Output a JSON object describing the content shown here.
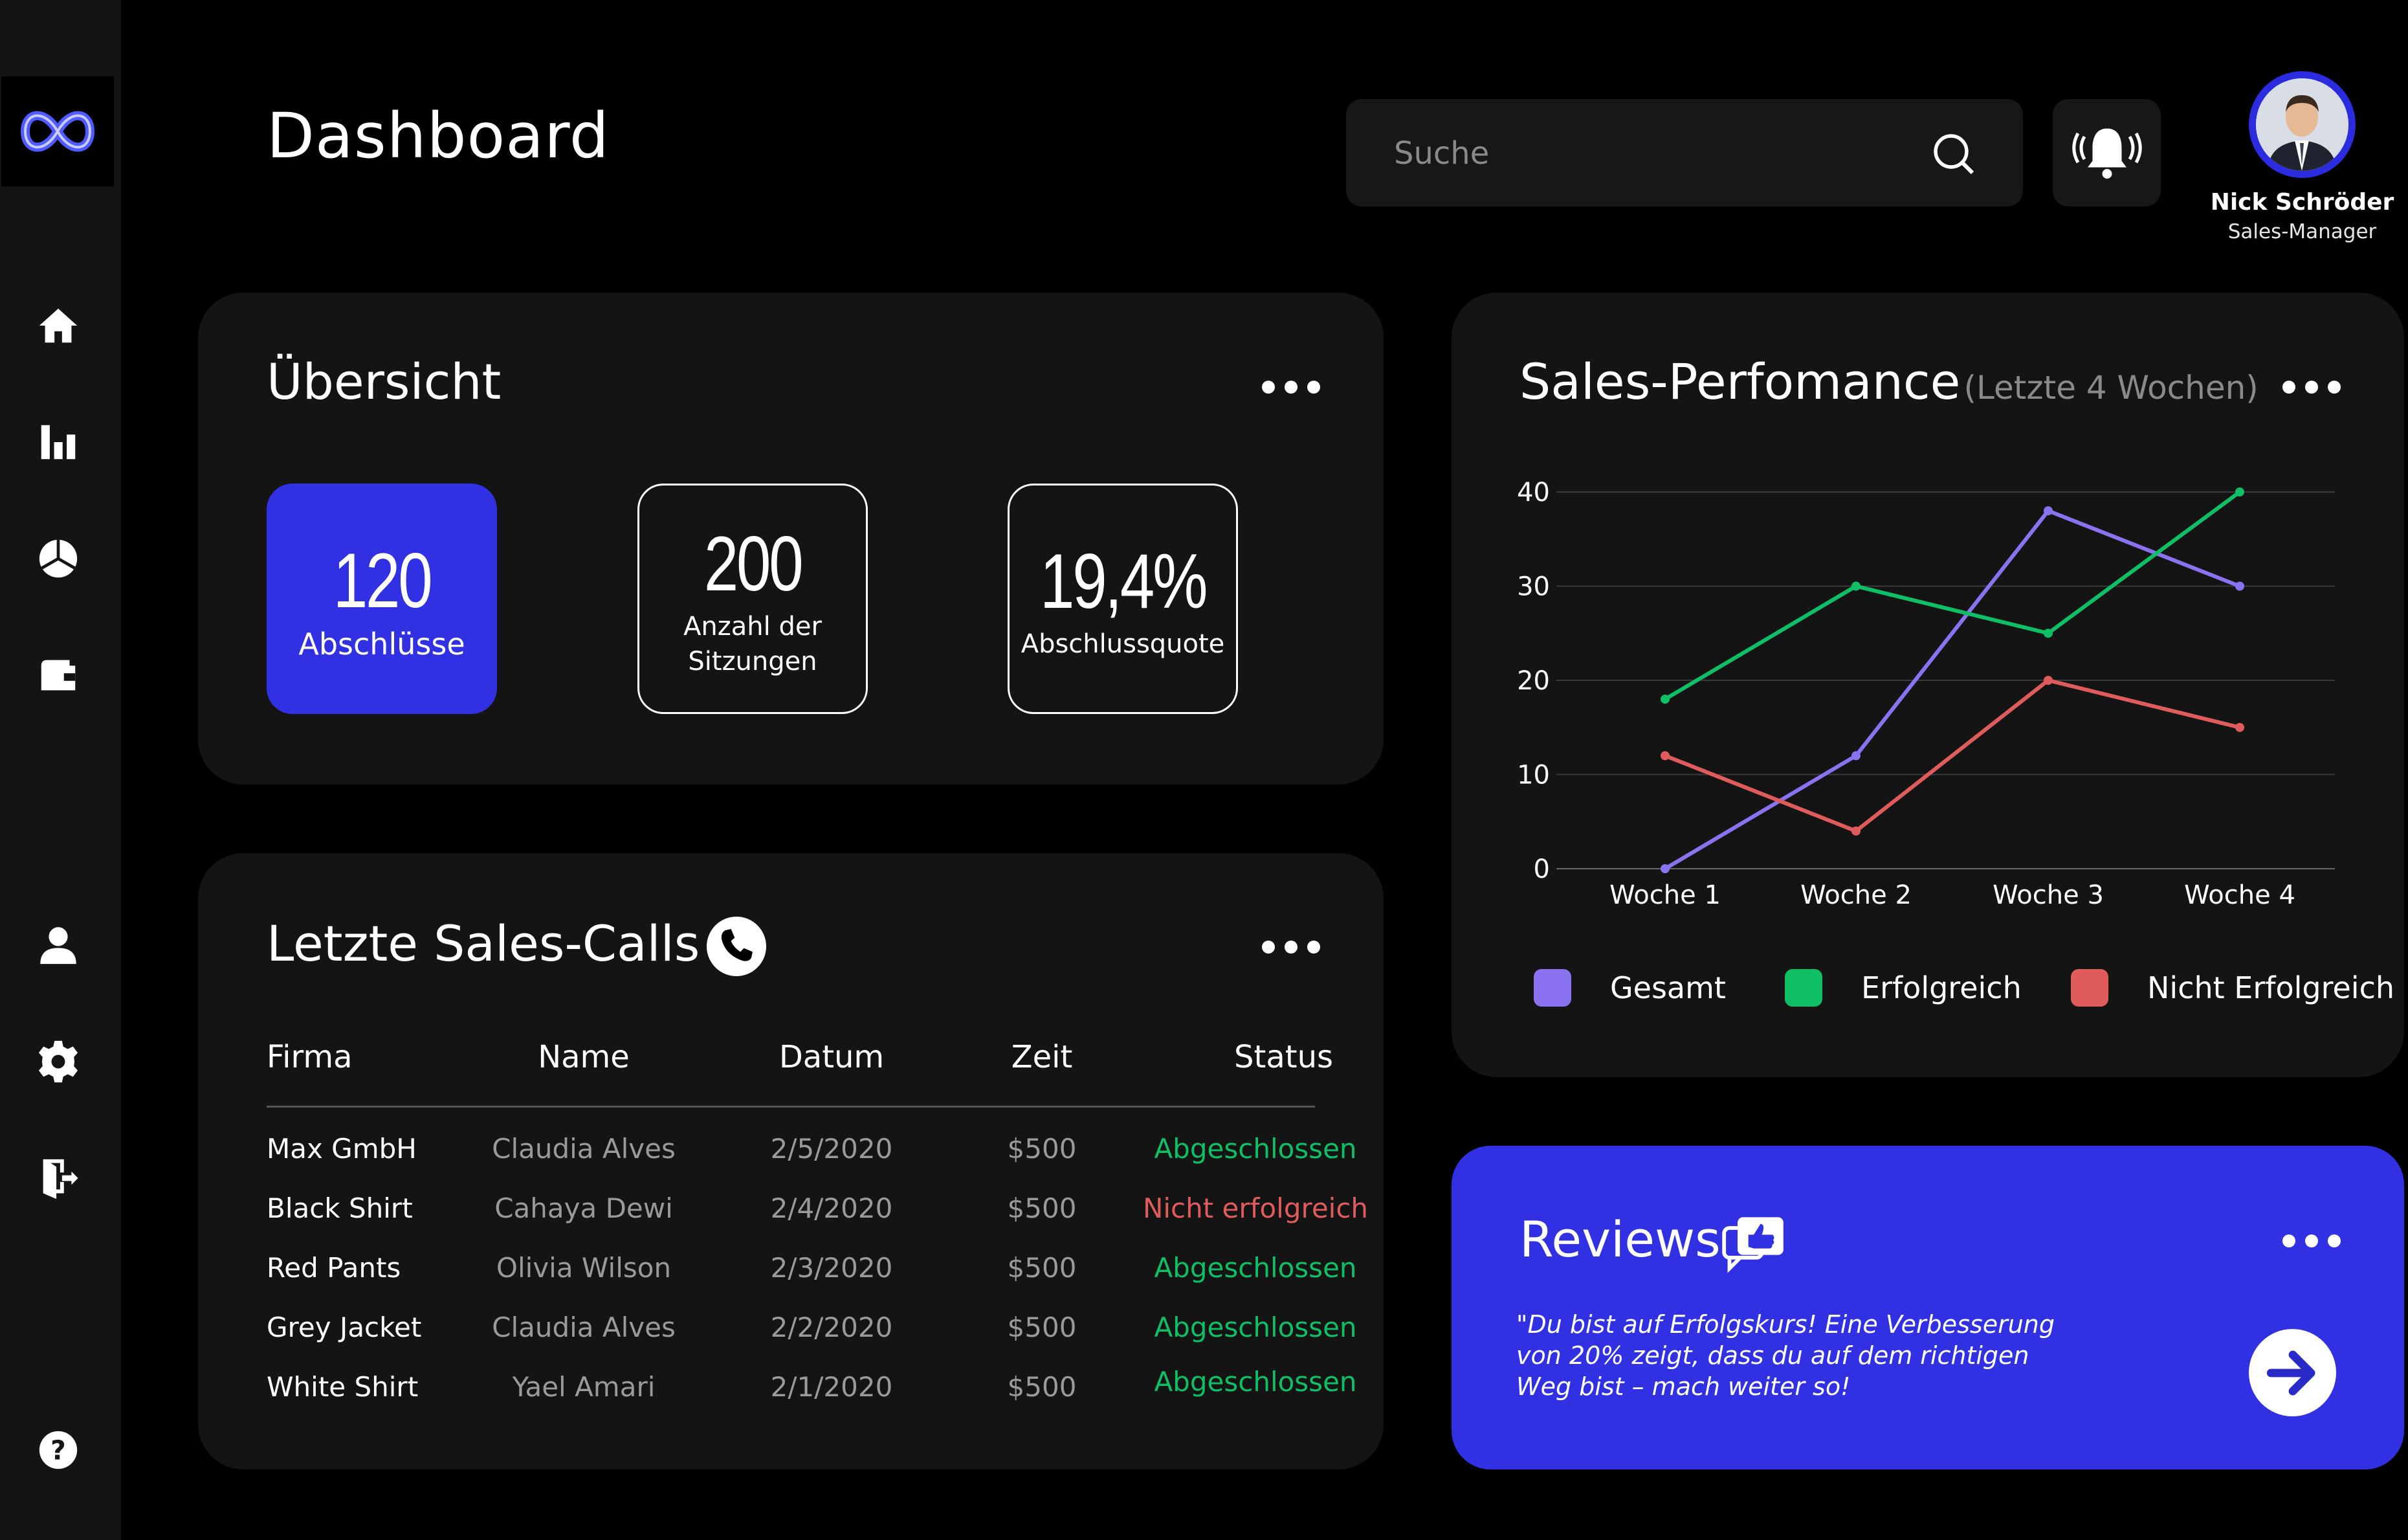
{
  "header": {
    "title": "Dashboard",
    "search_placeholder": "Suche"
  },
  "user": {
    "name": "Nick Schröder",
    "role": "Sales-Manager"
  },
  "sidebar": {
    "items": [
      "home-icon",
      "bar-chart-icon",
      "pie-chart-icon",
      "wallet-icon",
      "user-icon",
      "gear-icon",
      "logout-icon",
      "help-icon"
    ]
  },
  "overview": {
    "title": "Übersicht",
    "tiles": [
      {
        "value": "120",
        "label": "Abschlüsse"
      },
      {
        "value": "200",
        "label": "Anzahl der Sitzungen"
      },
      {
        "value": "19,4%",
        "label": "Abschlussquote"
      }
    ]
  },
  "calls": {
    "title": "Letzte Sales-Calls",
    "columns": [
      "Firma",
      "Name",
      "Datum",
      "Zeit",
      "Status"
    ],
    "rows": [
      {
        "firma": "Max GmbH",
        "name": "Claudia Alves",
        "datum": "2/5/2020",
        "zeit": "$500",
        "status": "Abgeschlossen"
      },
      {
        "firma": "Black Shirt",
        "name": "Cahaya Dewi",
        "datum": "2/4/2020",
        "zeit": "$500",
        "status": "Nicht erfolgreich"
      },
      {
        "firma": "Red Pants",
        "name": "Olivia Wilson",
        "datum": "2/3/2020",
        "zeit": "$500",
        "status": "Abgeschlossen"
      },
      {
        "firma": "Grey Jacket",
        "name": "Claudia Alves",
        "datum": "2/2/2020",
        "zeit": "$500",
        "status": "Abgeschlossen"
      },
      {
        "firma": "White Shirt",
        "name": "Yael Amari",
        "datum": "2/1/2020",
        "zeit": "$500",
        "status": "Abgeschlossen"
      }
    ]
  },
  "performance": {
    "title": "Sales-Perfomance",
    "subtitle": "(Letzte 4 Wochen)"
  },
  "chart_data": {
    "type": "line",
    "title": "Sales-Perfomance",
    "subtitle": "(Letzte 4 Wochen)",
    "categories": [
      "Woche 1",
      "Woche 2",
      "Woche 3",
      "Woche 4"
    ],
    "ylim": [
      0,
      40
    ],
    "yticks": [
      0,
      10,
      20,
      30,
      40
    ],
    "grid": true,
    "legend_position": "bottom",
    "series": [
      {
        "name": "Gesamt",
        "color": "#8a72f0",
        "values": [
          0,
          12,
          38,
          30
        ]
      },
      {
        "name": "Erfolgreich",
        "color": "#0fbf66",
        "values": [
          18,
          30,
          25,
          40
        ]
      },
      {
        "name": "Nicht Erfolgreich",
        "color": "#e05c5c",
        "values": [
          12,
          4,
          20,
          15
        ]
      }
    ]
  },
  "reviews": {
    "title": "Reviews",
    "quote_lines": [
      "\"Du bist auf Erfolgskurs! Eine Verbesserung",
      "von 20% zeigt, dass du auf dem richtigen",
      "Weg bist – mach weiter so!"
    ]
  },
  "colors": {
    "accent": "#3131e3",
    "success": "#0fbf66",
    "danger": "#e05c5c",
    "card": "#141414",
    "background": "#000000"
  }
}
